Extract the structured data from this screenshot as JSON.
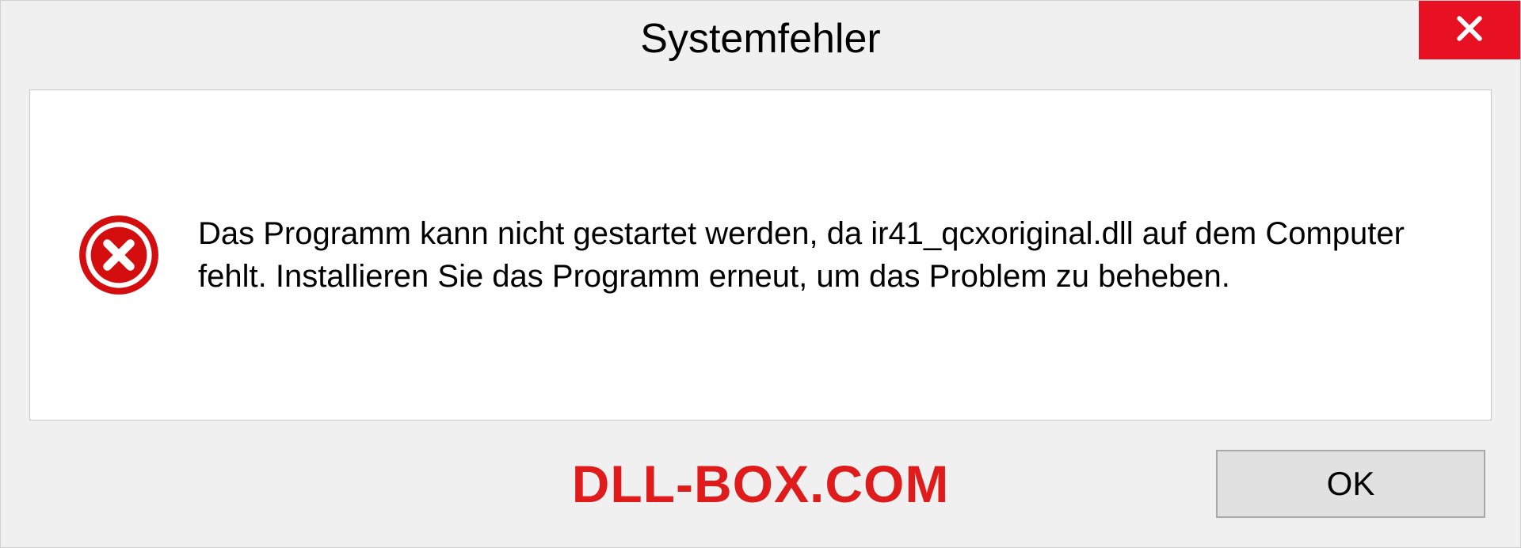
{
  "dialog": {
    "title": "Systemfehler",
    "message": "Das Programm kann nicht gestartet werden, da ir41_qcxoriginal.dll auf dem Computer fehlt. Installieren Sie das Programm erneut, um das Problem zu beheben.",
    "ok_label": "OK"
  },
  "watermark": "DLL-BOX.COM"
}
